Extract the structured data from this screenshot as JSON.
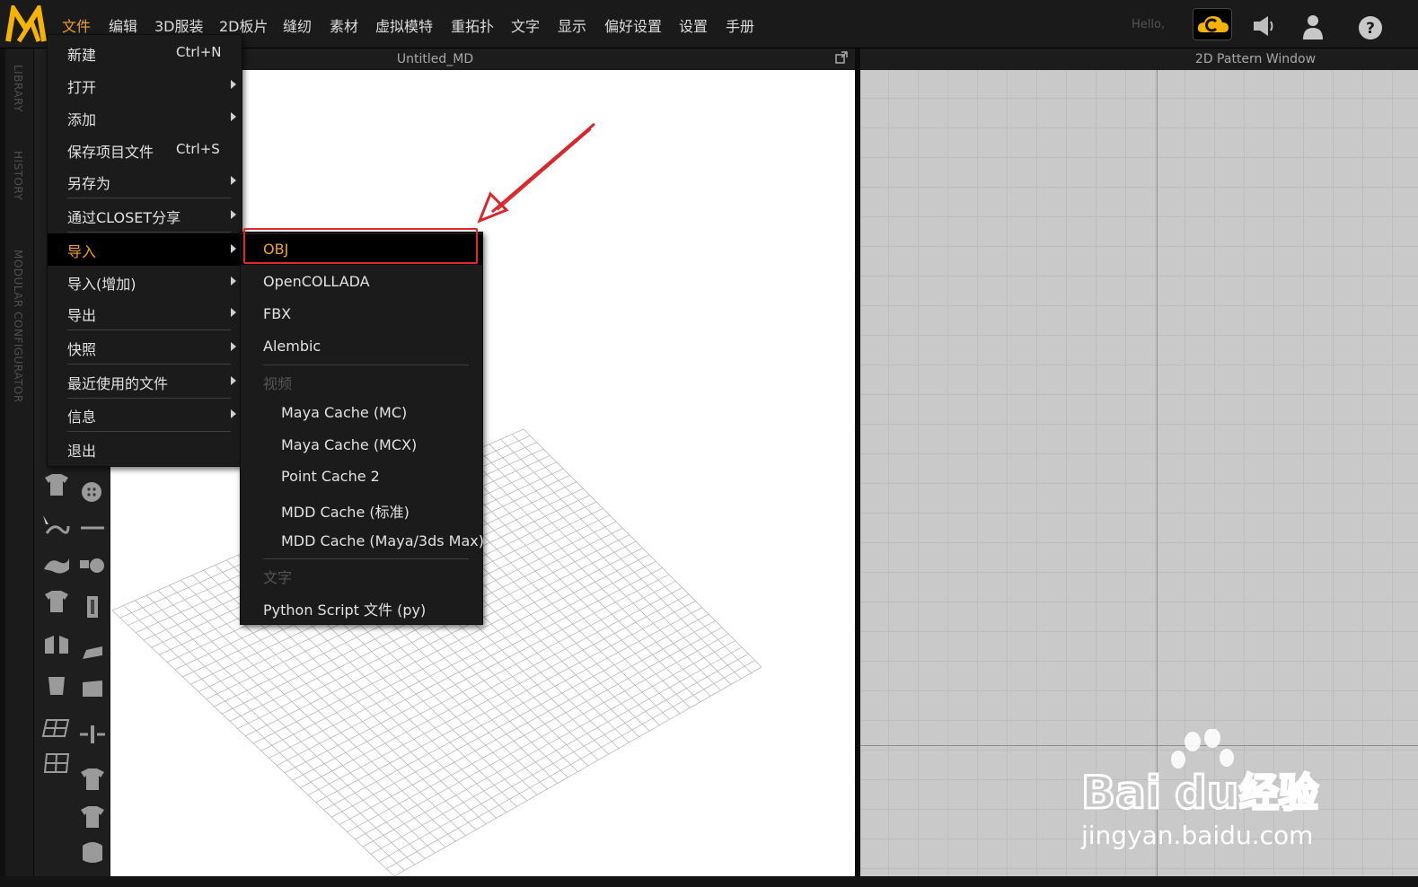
{
  "menubar": {
    "items": [
      "文件",
      "编辑",
      "3D服装",
      "2D板片",
      "缝纫",
      "素材",
      "虚拟模特",
      "重拓扑",
      "文字",
      "显示",
      "偏好设置",
      "设置",
      "手册"
    ],
    "hello": "Hello,"
  },
  "side_tabs": [
    "LIBRARY",
    "HISTORY",
    "MODULAR CONFIGURATOR"
  ],
  "windows": {
    "main_3d_title": "Untitled_MD",
    "pattern_2d_title": "2D Pattern Window"
  },
  "file_menu": {
    "items": [
      {
        "label": "新建",
        "shortcut": "Ctrl+N"
      },
      {
        "label": "打开"
      },
      {
        "label": "添加"
      },
      {
        "label": "保存项目文件",
        "shortcut": "Ctrl+S"
      },
      {
        "label": "另存为"
      },
      {
        "label": "通过CLOSET分享"
      },
      {
        "label": "导入"
      },
      {
        "label": "导入(增加)"
      },
      {
        "label": "导出"
      },
      {
        "label": "快照"
      },
      {
        "label": "最近使用的文件"
      },
      {
        "label": "信息"
      },
      {
        "label": "退出"
      }
    ]
  },
  "import_menu": {
    "items": [
      "OBJ",
      "OpenCOLLADA",
      "FBX",
      "Alembic",
      "视频",
      "Maya Cache (MC)",
      "Maya Cache (MCX)",
      "Point Cache 2",
      "MDD Cache (标准)",
      "MDD Cache (Maya/3ds Max)",
      "文字",
      "Python  Script 文件 (py)"
    ]
  },
  "watermark": {
    "brand": "Bai",
    "brand2": "du",
    "cn": "经验",
    "url": "jingyan.baidu.com"
  },
  "colors": {
    "accent": "#f0a030",
    "highlight_box": "#e0282d",
    "logo": "#f4b400"
  }
}
